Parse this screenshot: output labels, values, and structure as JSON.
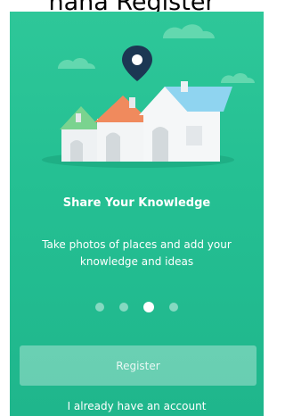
{
  "header": {
    "title": "nana Register"
  },
  "onboarding": {
    "headline": "Share Your Knowledge",
    "subtitle": "Take photos of places and add your knowledge and ideas",
    "current_page": 3,
    "page_count": 4
  },
  "actions": {
    "register_label": "Register",
    "login_link": "I already have an account"
  },
  "colors": {
    "background_green": "#25c093",
    "house_roof_green": "#7ad38f",
    "house_roof_orange": "#f08a5d",
    "house_roof_blue": "#8fd4f0",
    "pin_navy": "#1c3753",
    "house_wall": "#f4f5f7"
  },
  "icons": {
    "location_pin": "location-pin-icon",
    "houses_illustration": "houses-illustration",
    "clouds": "cloud-icon"
  }
}
